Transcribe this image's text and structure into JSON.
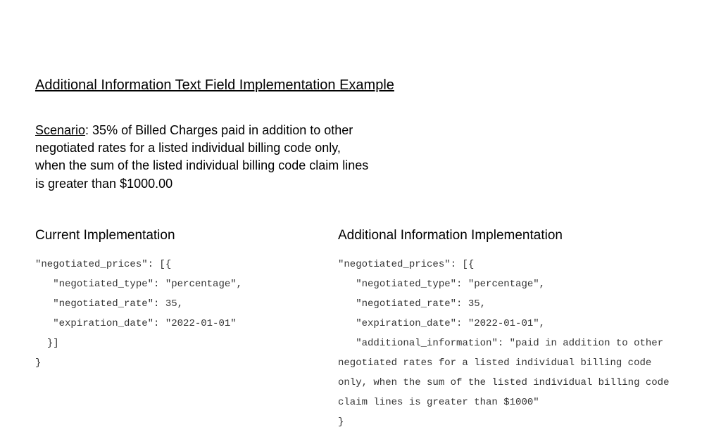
{
  "title": "Additional Information Text Field Implementation Example",
  "scenario": {
    "label": "Scenario",
    "text": ": 35% of Billed Charges paid in addition to other negotiated rates for a listed individual billing code only, when the sum of the listed individual billing code claim lines is greater than $1000.00"
  },
  "left": {
    "heading": "Current Implementation",
    "code": "\"negotiated_prices\": [{\n   \"negotiated_type\": \"percentage\",\n   \"negotiated_rate\": 35,\n   \"expiration_date\": \"2022-01-01\"\n  }]\n}"
  },
  "right": {
    "heading": "Additional Information Implementation",
    "code": "\"negotiated_prices\": [{\n   \"negotiated_type\": \"percentage\",\n   \"negotiated_rate\": 35,\n   \"expiration_date\": \"2022-01-01\",\n   \"additional_information\": \"paid in addition to other negotiated rates for a listed individual billing code only, when the sum of the listed individual billing code claim lines is greater than $1000\"\n}"
  }
}
